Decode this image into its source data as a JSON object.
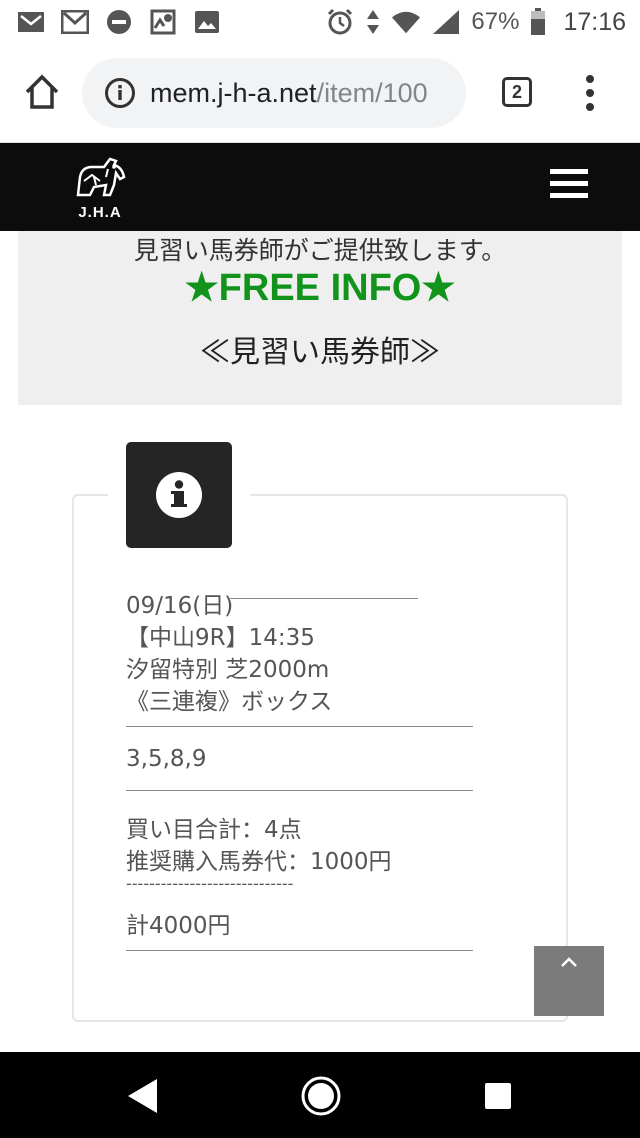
{
  "status_bar": {
    "battery_percent": "67%",
    "time": "17:16",
    "left_icons": [
      "missed-call-icon",
      "gmail-icon",
      "dnd-icon",
      "location-icon",
      "image-icon"
    ],
    "right_icons": [
      "alarm-icon",
      "data-arrows-icon",
      "wifi-icon",
      "signal-icon",
      "battery-icon"
    ]
  },
  "browser": {
    "url_host": "mem.j-h-a.net",
    "url_path": "/item/100",
    "tab_count": "2"
  },
  "site": {
    "logo_text": "J.H.A"
  },
  "promo": {
    "line1": "見習い馬券師がご提供致します。",
    "free_info": "★FREE INFO★",
    "name": "≪見習い馬券師≫"
  },
  "race_info": {
    "date": "09/16(日)",
    "race": "【中山9R】14:35",
    "race_name": "汐留特別 芝2000m",
    "bet_type": "《三連複》ボックス",
    "numbers": "3,5,8,9",
    "combo_total": "買い目合計：4点",
    "recommended_price": "推奨購入馬券代：1000円",
    "separator": "-----------------------------",
    "total": "計4000円"
  },
  "colors": {
    "free_info_green": "#12941c",
    "header_black": "#0c0c0c",
    "promo_bg": "#efefef",
    "to_top_gray": "#7b7b7b"
  }
}
